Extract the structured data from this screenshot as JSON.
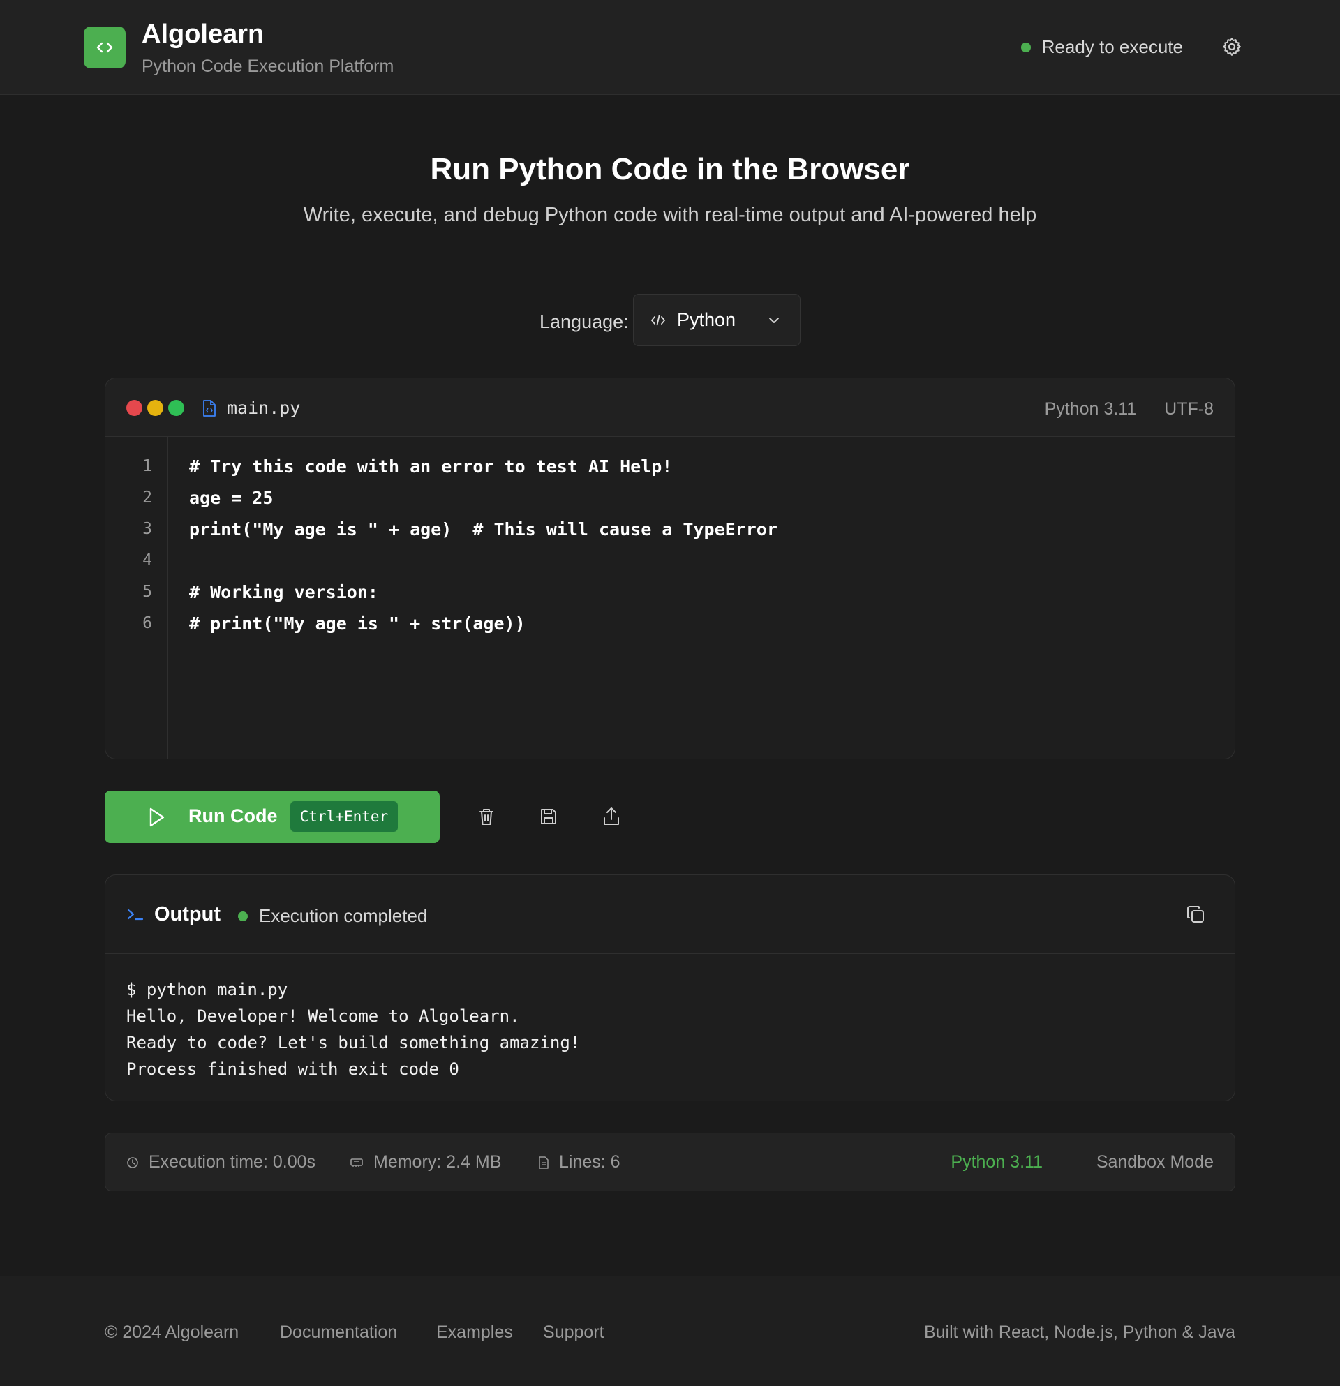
{
  "header": {
    "brand_title": "Algolearn",
    "brand_subtitle": "Python Code Execution Platform",
    "status_text": "Ready to execute"
  },
  "hero": {
    "title": "Run Python Code in the Browser",
    "subtitle": "Write, execute, and debug Python code with real-time output and AI-powered help"
  },
  "language": {
    "label": "Language:",
    "selected": "Python"
  },
  "editor": {
    "file_name": "main.py",
    "version": "Python 3.11",
    "encoding": "UTF-8",
    "line_numbers": [
      "1",
      "2",
      "3",
      "4",
      "5",
      "6"
    ],
    "lines": [
      "# Try this code with an error to test AI Help!",
      "age = 25",
      "print(\"My age is \" + age)  # This will cause a TypeError",
      "",
      "# Working version:",
      "# print(\"My age is \" + str(age))"
    ]
  },
  "toolbar": {
    "run_label": "Run Code",
    "shortcut": "Ctrl+Enter"
  },
  "output": {
    "title": "Output",
    "status": "Execution completed",
    "lines": [
      "$ python main.py",
      "Hello, Developer! Welcome to Algolearn.",
      "Ready to code? Let's build something amazing!",
      "Process finished with exit code 0"
    ]
  },
  "stats": {
    "exec_time": "Execution time: 0.00s",
    "memory": "Memory: 2.4 MB",
    "lines": "Lines: 6",
    "version": "Python 3.11",
    "mode": "Sandbox Mode"
  },
  "footer": {
    "copyright": "© 2024 Algolearn",
    "links": [
      "Documentation",
      "Examples",
      "Support"
    ],
    "built_with": "Built with React, Node.js, Python & Java"
  },
  "colors": {
    "accent": "#4caf50",
    "background": "#1b1b1b",
    "panel": "#1e1e1e",
    "traffic_red": "#e5484d",
    "traffic_yellow": "#e5b30f",
    "traffic_green": "#2fbf55",
    "file_icon_blue": "#3b82f6"
  }
}
